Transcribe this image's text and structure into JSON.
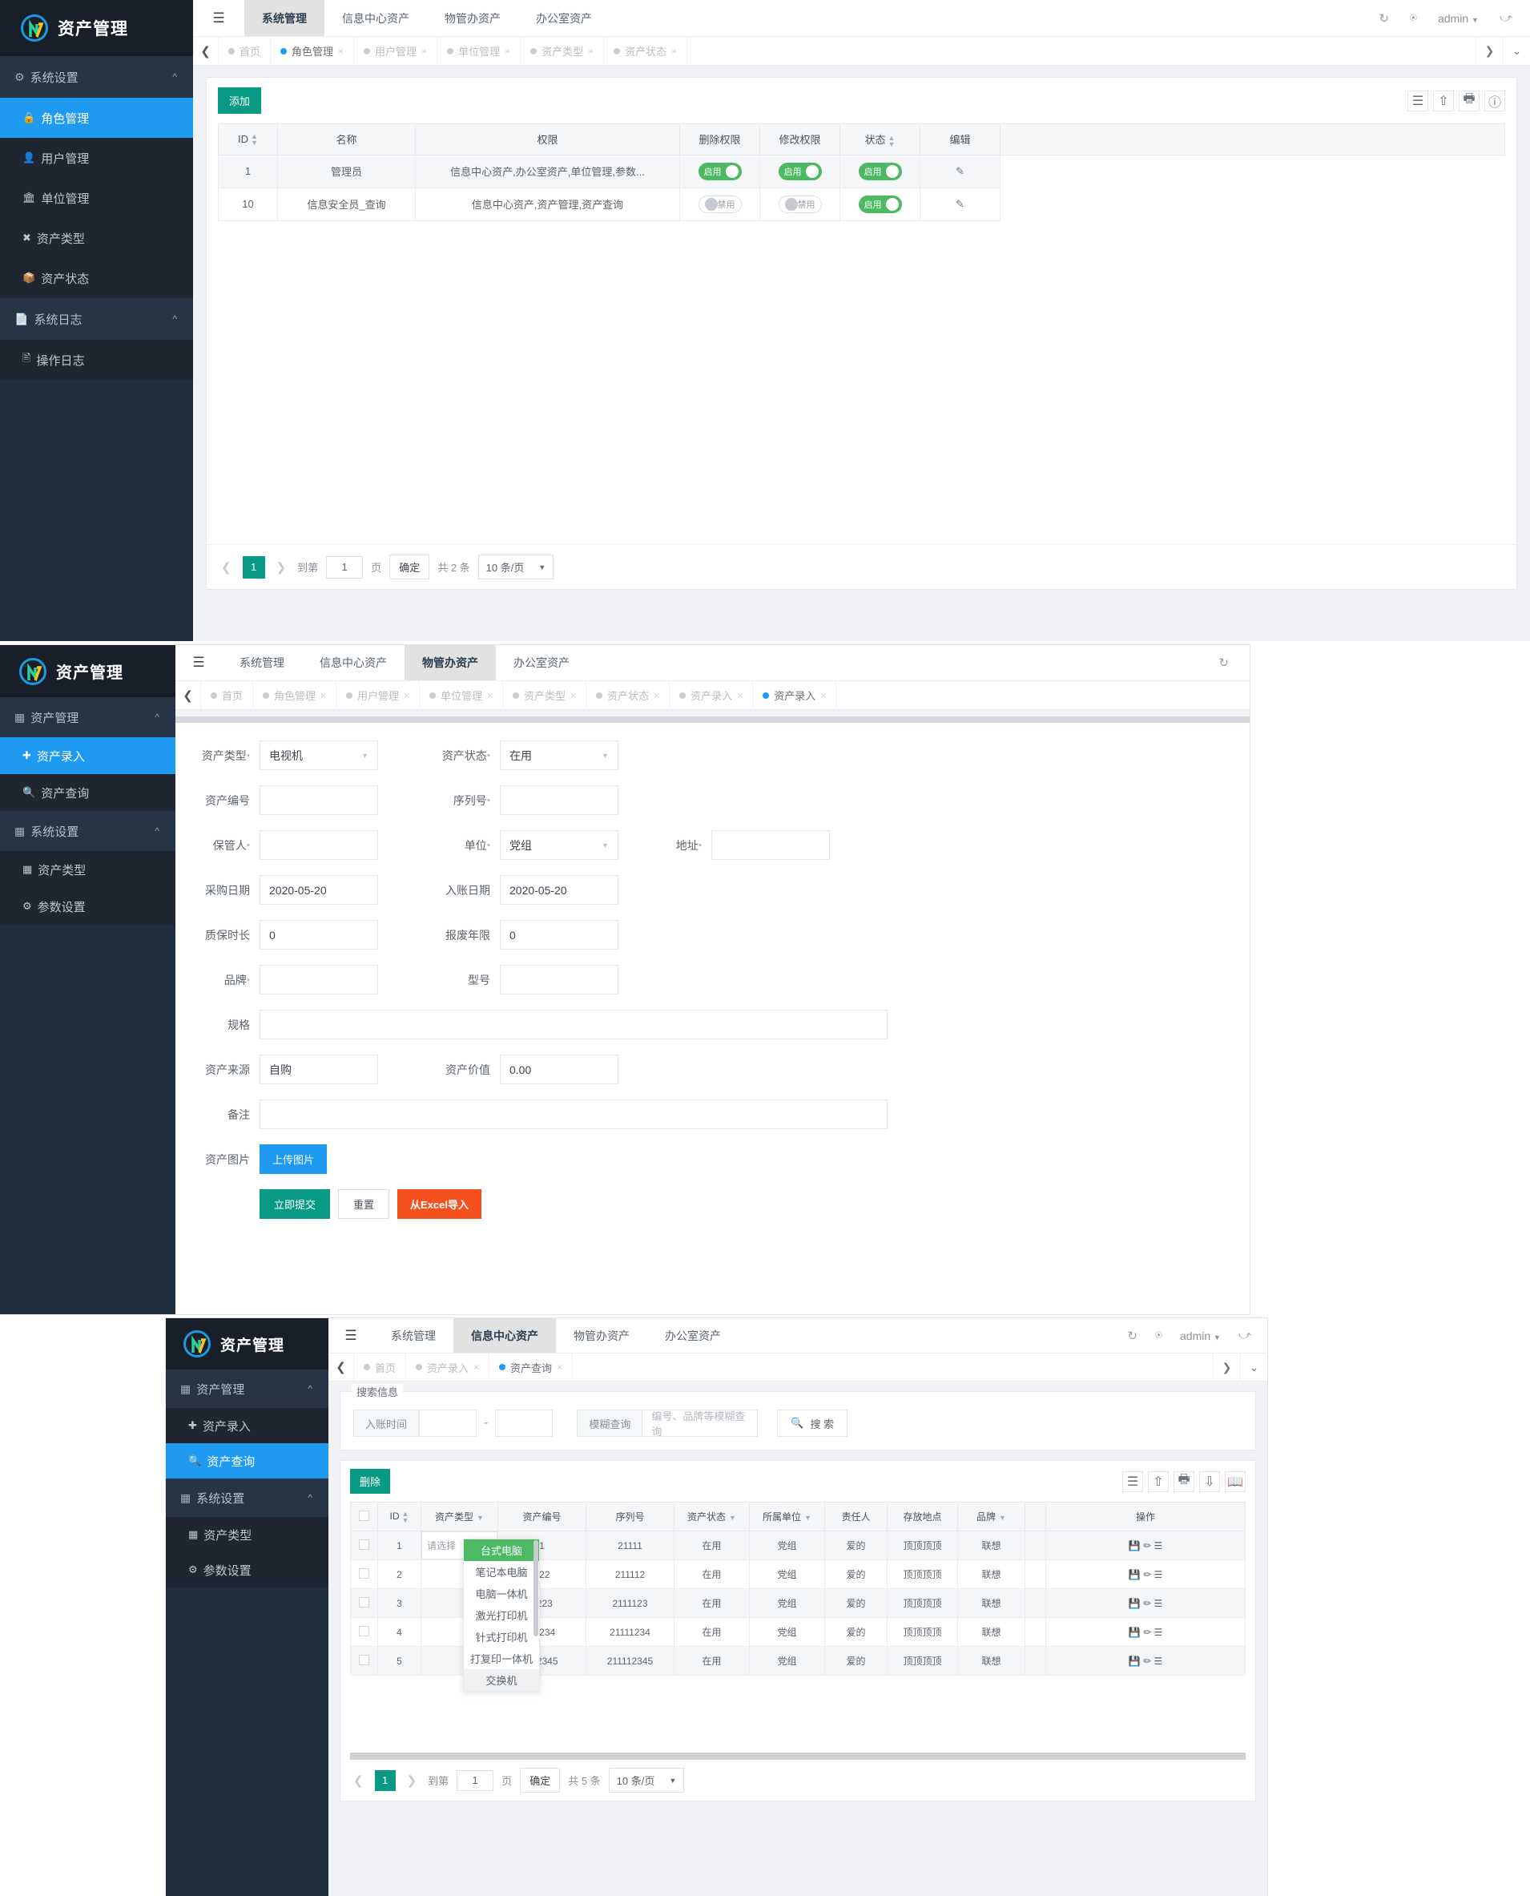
{
  "brand": {
    "title": "资产管理"
  },
  "topbar": {
    "hamburger_icon": "menu-fold-icon",
    "tabs": [
      "系统管理",
      "信息中心资产",
      "物管办资产",
      "办公室资产"
    ],
    "refresh_icon": "refresh-icon",
    "dashboard_icon": "dashboard-icon",
    "user": "admin",
    "fullscreen_icon": "fullscreen-icon"
  },
  "window1": {
    "active_tab": "系统管理",
    "sidebar": {
      "groups": [
        {
          "label": "系统设置",
          "icon": "gear-icon",
          "items": [
            {
              "label": "角色管理",
              "icon": "lock-icon",
              "active": true
            },
            {
              "label": "用户管理",
              "icon": "user-icon",
              "active": false
            },
            {
              "label": "单位管理",
              "icon": "bank-icon",
              "active": false
            },
            {
              "label": "资产类型",
              "icon": "tag-icon",
              "active": false
            },
            {
              "label": "资产状态",
              "icon": "box-icon",
              "active": false
            }
          ]
        },
        {
          "label": "系统日志",
          "icon": "file-icon",
          "items": [
            {
              "label": "操作日志",
              "icon": "doc-icon",
              "active": false
            }
          ]
        }
      ]
    },
    "page_tabs": [
      {
        "label": "首页",
        "sel": false,
        "closable": false
      },
      {
        "label": "角色管理",
        "sel": true,
        "closable": true
      },
      {
        "label": "用户管理",
        "sel": false,
        "closable": true
      },
      {
        "label": "单位管理",
        "sel": false,
        "closable": true
      },
      {
        "label": "资产类型",
        "sel": false,
        "closable": true
      },
      {
        "label": "资产状态",
        "sel": false,
        "closable": true
      }
    ],
    "toolbar": {
      "add_label": "添加",
      "icons": [
        "columns-icon",
        "export-icon",
        "print-icon",
        "info-icon"
      ]
    },
    "table": {
      "columns": [
        "ID",
        "名称",
        "权限",
        "删除权限",
        "修改权限",
        "状态",
        "编辑"
      ],
      "rows": [
        {
          "id": "1",
          "name": "管理员",
          "perm": "信息中心资产,办公室资产,单位管理,参数...",
          "del": "启用",
          "del_on": true,
          "mod": "启用",
          "mod_on": true,
          "status": "启用",
          "status_on": true,
          "edit_icon": "pencil-icon"
        },
        {
          "id": "10",
          "name": "信息安全员_查询",
          "perm": "信息中心资产,资产管理,资产查询",
          "del": "禁用",
          "del_on": false,
          "mod": "禁用",
          "mod_on": false,
          "status": "启用",
          "status_on": true,
          "edit_icon": "pencil-icon"
        }
      ]
    },
    "pager": {
      "page": "1",
      "goto_prefix": "到第",
      "goto_value": "1",
      "goto_suffix": "页",
      "confirm": "确定",
      "total": "共 2 条",
      "page_size": "10 条/页"
    }
  },
  "window2": {
    "active_tab": "物管办资产",
    "sidebar": {
      "groups": [
        {
          "label": "资产管理",
          "icon": "book-icon",
          "items": [
            {
              "label": "资产录入",
              "icon": "plus-square-icon",
              "active": true
            },
            {
              "label": "资产查询",
              "icon": "search-icon",
              "active": false
            }
          ]
        },
        {
          "label": "系统设置",
          "icon": "book-icon",
          "items": [
            {
              "label": "资产类型",
              "icon": "book-icon",
              "active": false
            },
            {
              "label": "参数设置",
              "icon": "gear-icon",
              "active": false
            }
          ]
        }
      ]
    },
    "page_tabs": [
      {
        "label": "首页",
        "sel": false,
        "closable": false
      },
      {
        "label": "角色管理",
        "sel": false,
        "closable": true
      },
      {
        "label": "用户管理",
        "sel": false,
        "closable": true
      },
      {
        "label": "单位管理",
        "sel": false,
        "closable": true
      },
      {
        "label": "资产类型",
        "sel": false,
        "closable": true
      },
      {
        "label": "资产状态",
        "sel": false,
        "closable": true
      },
      {
        "label": "资产录入",
        "sel": false,
        "closable": true
      },
      {
        "label": "资产录入",
        "sel": true,
        "closable": true
      }
    ],
    "form": {
      "asset_type_label": "资产类型",
      "asset_type_value": "电视机",
      "asset_status_label": "资产状态",
      "asset_status_value": "在用",
      "asset_no_label": "资产编号",
      "asset_no_value": "",
      "serial_label": "序列号",
      "serial_value": "",
      "keeper_label": "保管人",
      "keeper_value": "",
      "unit_label": "单位",
      "unit_value": "党组",
      "address_label": "地址",
      "address_value": "",
      "purchase_date_label": "采购日期",
      "purchase_date_value": "2020-05-20",
      "entry_date_label": "入账日期",
      "entry_date_value": "2020-05-20",
      "warranty_label": "质保时长",
      "warranty_value": "0",
      "scrap_label": "报废年限",
      "scrap_value": "0",
      "brand_label": "品牌",
      "brand_value": "",
      "model_label": "型号",
      "model_value": "",
      "spec_label": "规格",
      "spec_value": "",
      "source_label": "资产来源",
      "source_value": "自购",
      "value_label": "资产价值",
      "value_value": "0.00",
      "remark_label": "备注",
      "remark_value": "",
      "image_label": "资产图片",
      "upload_label": "上传图片",
      "submit_label": "立即提交",
      "reset_label": "重置",
      "excel_label": "从Excel导入"
    }
  },
  "window3": {
    "active_tab": "信息中心资产",
    "sidebar": {
      "groups": [
        {
          "label": "资产管理",
          "icon": "book-icon",
          "items": [
            {
              "label": "资产录入",
              "icon": "plus-square-icon",
              "active": false
            },
            {
              "label": "资产查询",
              "icon": "search-icon",
              "active": true
            }
          ]
        },
        {
          "label": "系统设置",
          "icon": "book-icon",
          "items": [
            {
              "label": "资产类型",
              "icon": "book-icon",
              "active": false
            },
            {
              "label": "参数设置",
              "icon": "gear-icon",
              "active": false
            }
          ]
        }
      ]
    },
    "page_tabs": [
      {
        "label": "首页",
        "sel": false,
        "closable": false
      },
      {
        "label": "资产录入",
        "sel": false,
        "closable": true
      },
      {
        "label": "资产查询",
        "sel": true,
        "closable": true
      }
    ],
    "search": {
      "legend": "搜索信息",
      "date_label": "入账时间",
      "date_from": "",
      "date_to": "",
      "dash": "-",
      "fuzzy_label": "模糊查询",
      "fuzzy_placeholder": "编号、品牌等模糊查询",
      "search_button": "搜 索",
      "search_icon": "search-icon"
    },
    "toolbar": {
      "delete_label": "删除",
      "icons": [
        "columns-icon",
        "export-icon",
        "print-icon",
        "download-icon",
        "book-open-icon"
      ]
    },
    "table": {
      "columns": [
        "ID",
        "资产类型",
        "资产编号",
        "序列号",
        "资产状态",
        "所属单位",
        "责任人",
        "存放地点",
        "品牌",
        "操作"
      ],
      "filter_cols": [
        "资产类型",
        "资产状态",
        "所属单位",
        "品牌"
      ],
      "rows": [
        {
          "id": "1",
          "type": "请选择",
          "no": "1",
          "serial": "21111",
          "status": "在用",
          "unit": "党组",
          "owner": "爱的",
          "place": "顶顶顶顶",
          "brand": "联想"
        },
        {
          "id": "2",
          "type": "",
          "no": "122",
          "serial": "211112",
          "status": "在用",
          "unit": "党组",
          "owner": "爱的",
          "place": "顶顶顶顶",
          "brand": "联想"
        },
        {
          "id": "3",
          "type": "",
          "no": "1223",
          "serial": "2111123",
          "status": "在用",
          "unit": "党组",
          "owner": "爱的",
          "place": "顶顶顶顶",
          "brand": "联想"
        },
        {
          "id": "4",
          "type": "",
          "no": "12234",
          "serial": "21111234",
          "status": "在用",
          "unit": "党组",
          "owner": "爱的",
          "place": "顶顶顶顶",
          "brand": "联想"
        },
        {
          "id": "5",
          "type": "",
          "no": "122345",
          "serial": "211112345",
          "status": "在用",
          "unit": "党组",
          "owner": "爱的",
          "place": "顶顶顶顶",
          "brand": "联想"
        }
      ],
      "row_action_icons": [
        "save-icon",
        "edit-icon",
        "detail-icon"
      ]
    },
    "dropdown": {
      "options": [
        "台式电脑",
        "笔记本电脑",
        "电脑一体机",
        "激光打印机",
        "针式打印机",
        "打复印一体机",
        "交换机"
      ],
      "selected": "台式电脑",
      "hovered": "交换机"
    },
    "pager": {
      "page": "1",
      "goto_prefix": "到第",
      "goto_value": "1",
      "goto_suffix": "页",
      "confirm": "确定",
      "total": "共 5 条",
      "page_size": "10 条/页"
    }
  },
  "colors": {
    "accent_blue": "#1e9bf0",
    "teal": "#089a84",
    "green": "#4cb963",
    "orange": "#f4511e",
    "sidebar_dark": "#1f2d3d"
  }
}
